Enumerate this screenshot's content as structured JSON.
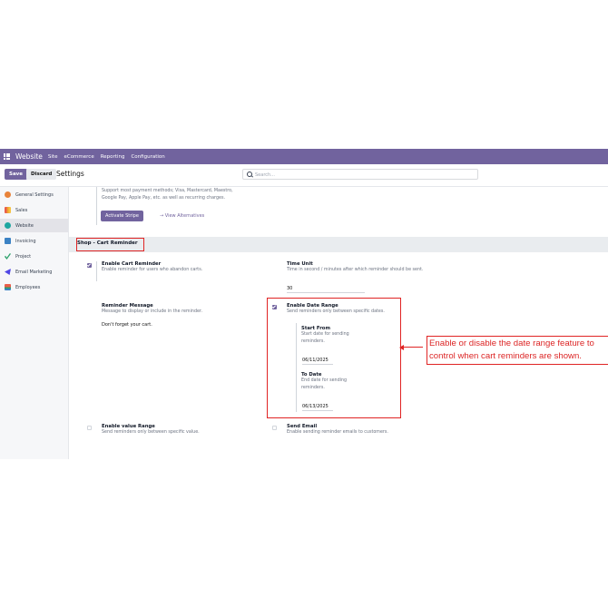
{
  "navbar": {
    "app_name": "Website",
    "menu": [
      "Site",
      "eCommerce",
      "Reporting",
      "Configuration"
    ]
  },
  "control": {
    "save_label": "Save",
    "discard_label": "Discard",
    "breadcrumb": "Settings",
    "search_placeholder": "Search..."
  },
  "sidebar": {
    "items": [
      {
        "label": "General Settings",
        "icon": "general-settings-icon",
        "color": "#e8833a"
      },
      {
        "label": "Sales",
        "icon": "sales-icon",
        "color": "#f0a030"
      },
      {
        "label": "Website",
        "icon": "website-icon",
        "color": "#1ea6a0",
        "active": true
      },
      {
        "label": "Invoicing",
        "icon": "invoicing-icon",
        "color": "#3b82c4"
      },
      {
        "label": "Project",
        "icon": "project-icon",
        "color": "#2aa16a"
      },
      {
        "label": "Email Marketing",
        "icon": "email-marketing-icon",
        "color": "#4f46e5"
      },
      {
        "label": "Employees",
        "icon": "employees-icon",
        "color": "#e85d4a"
      }
    ]
  },
  "payment": {
    "desc_line1": "Support most payment methods; Visa, Mastercard, Maestro,",
    "desc_line2": "Google Pay, Apple Pay, etc. as well as recurring charges.",
    "activate_label": "Activate Stripe",
    "alternatives_label": "→  View Alternatives"
  },
  "section_title": "Shop - Cart Reminder",
  "settings": {
    "cart_reminder": {
      "title": "Enable Cart Reminder",
      "desc": "Enable reminder for users who abandon carts.",
      "checked": true
    },
    "time_unit": {
      "title": "Time Unit",
      "desc": "Time in second / minutes after which reminder should be sent.",
      "value": "30"
    },
    "reminder_message": {
      "title": "Reminder Message",
      "desc": "Message to display or include in the reminder.",
      "value": "Don't forget your cart."
    },
    "date_range": {
      "title": "Enable Date Range",
      "desc": "Send reminders only between specific dates.",
      "checked": true,
      "start": {
        "title": "Start From",
        "desc_line1": "Start date for sending",
        "desc_line2": "reminders.",
        "value": "06/11/2025"
      },
      "end": {
        "title": "To Date",
        "desc_line1": "End date for sending",
        "desc_line2": "reminders.",
        "value": "06/13/2025"
      }
    },
    "value_range": {
      "title": "Enable value Range",
      "desc": "Send reminders only between specific value.",
      "checked": false
    },
    "send_email": {
      "title": "Send Email",
      "desc": "Enable sending reminder emails to customers.",
      "checked": false
    }
  },
  "annotation": {
    "line1": "Enable or disable the date range feature to",
    "line2": "control when cart reminders are shown."
  },
  "colors": {
    "brand": "#71639e",
    "highlight": "#e02424"
  }
}
